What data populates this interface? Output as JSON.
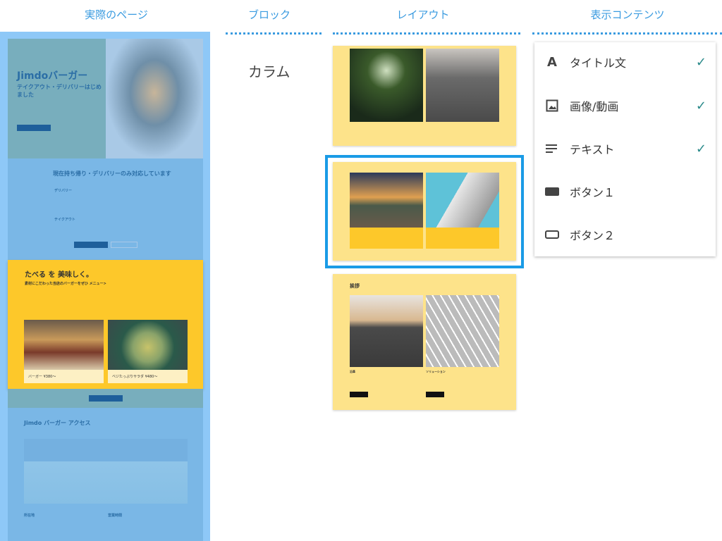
{
  "headers": {
    "actual_page": "実際のページ",
    "block": "ブロック",
    "layout": "レイアウト",
    "contents": "表示コンテンツ"
  },
  "page": {
    "title": "Jimdoバーガー",
    "subtitle": "テイクアウト・デリバリーはじめました",
    "section_title": "現在持ち帰り・デリバリーのみ対応しています",
    "delivery": "デリバリー",
    "takeout": "テイクアウト",
    "menu_heading": "たべる を 美味しく。",
    "menu_sub": "素材にこだわった当店のバーガーをぜひ メニュー>",
    "cards": [
      {
        "caption": "バーガー ¥380〜"
      },
      {
        "caption": "ベジたっぷりサラダ ¥480〜"
      }
    ],
    "access_title": "Jimdo バーガー アクセス",
    "address_label": "所在地",
    "hours_label": "営業時間"
  },
  "block": {
    "name": "カラム"
  },
  "layouts": [
    {
      "heading": ""
    },
    {
      "heading": ""
    },
    {
      "heading": "挨拶",
      "captions": [
        "沿革",
        "ソリューション"
      ]
    }
  ],
  "contents": [
    {
      "icon": "title-icon",
      "label": "タイトル文",
      "checked": true
    },
    {
      "icon": "image-icon",
      "label": "画像/動画",
      "checked": true
    },
    {
      "icon": "text-icon",
      "label": "テキスト",
      "checked": true
    },
    {
      "icon": "button-filled-icon",
      "label": "ボタン１",
      "checked": false
    },
    {
      "icon": "button-outline-icon",
      "label": "ボタン２",
      "checked": false
    }
  ],
  "check": "✓"
}
